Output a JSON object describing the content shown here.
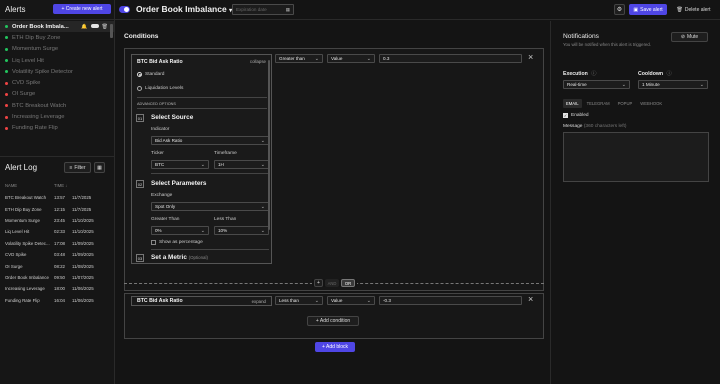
{
  "sidebar": {
    "title": "Alerts",
    "create_label": "+ Create new alert",
    "items": [
      {
        "label": "Order Book Imbala...",
        "color": "#22c55e",
        "active": true
      },
      {
        "label": "ETH Dip Buy Zone",
        "color": "#22c55e"
      },
      {
        "label": "Momentum Surge",
        "color": "#22c55e"
      },
      {
        "label": "Liq Level Hit",
        "color": "#22c55e"
      },
      {
        "label": "Volatility Spike Detector",
        "color": "#22c55e"
      },
      {
        "label": "CVD Spike",
        "color": "#ef4444"
      },
      {
        "label": "OI Surge",
        "color": "#ef4444"
      },
      {
        "label": "BTC Breakout Watch",
        "color": "#ef4444"
      },
      {
        "label": "Increasing Leverage",
        "color": "#ef4444"
      },
      {
        "label": "Funding Rate Flip",
        "color": "#ef4444"
      }
    ]
  },
  "log": {
    "title": "Alert Log",
    "filter_label": "Filter",
    "col_name": "NAME",
    "col_time": "TIME ↓",
    "rows": [
      [
        "BTC Breakout Watch",
        "13:57",
        "11/7/2025"
      ],
      [
        "ETH Dip Buy Zone",
        "12:15",
        "11/7/2025"
      ],
      [
        "Momentum Surge",
        "23:45",
        "11/10/2025"
      ],
      [
        "Liq Level Hit",
        "02:33",
        "11/10/2025"
      ],
      [
        "Volatility Spike Detec...",
        "17:08",
        "11/09/2025"
      ],
      [
        "CVD Spike",
        "03:48",
        "11/09/2025"
      ],
      [
        "OI Surge",
        "08:22",
        "11/08/2025"
      ],
      [
        "Order Book Imbalance",
        "09:50",
        "11/07/2025"
      ],
      [
        "Increasing Leverage",
        "18:00",
        "11/06/2025"
      ],
      [
        "Funding Rate Flip",
        "16:04",
        "11/06/2025"
      ]
    ]
  },
  "topbar": {
    "alert_name": "Order Book Imbalance",
    "expiration_placeholder": "Expiration date",
    "save_label": "Save alert",
    "delete_label": "Delete alert"
  },
  "conditions": {
    "title": "Conditions",
    "block1": {
      "metric": "BTC Bid Ask Ratio",
      "collapse": "collapse",
      "operator": "Greater than",
      "value_type": "Value",
      "value": "0.3",
      "mode_standard": "Standard",
      "mode_liq": "Liquidation Levels",
      "advanced": "ADVANCED OPTIONS",
      "s1_num": "01",
      "s1_title": "Select Source",
      "indicator_label": "Indicator",
      "indicator_value": "Bid Ask Ratio",
      "ticker_label": "Ticker",
      "ticker_value": "BTC",
      "timeframe_label": "Timeframe",
      "timeframe_value": "1H",
      "s2_num": "02",
      "s2_title": "Select Parameters",
      "exchange_label": "Exchange",
      "exchange_value": "Spot Only",
      "gt_label": "Greater Than",
      "gt_value": "0%",
      "lt_label": "Less Than",
      "lt_value": "10%",
      "show_pct": "Show as percentage",
      "s3_num": "03",
      "s3_title": "Set a Metric",
      "s3_optional": "(Optional)"
    },
    "and_label": "AND",
    "or_label": "OR",
    "plus_label": "+",
    "block2": {
      "metric": "BTC Bid Ask Ratio",
      "expand": "expand",
      "operator": "Less than",
      "value_type": "Value",
      "value": "-0.3"
    },
    "add_condition": "+ Add condition",
    "add_block": "+ Add block"
  },
  "notifications": {
    "title": "Notifications",
    "subtitle": "You will be notified when this alert is triggered.",
    "mute_label": "Mute",
    "execution_label": "Execution",
    "execution_value": "Real-time",
    "cooldown_label": "Cooldown",
    "cooldown_value": "1 Minute",
    "tabs": [
      "EMAIL",
      "TELEGRAM",
      "POPUP",
      "WEBHOOK"
    ],
    "enabled_label": "Enabled",
    "message_label": "Message",
    "message_hint": "(360 characters left)"
  }
}
